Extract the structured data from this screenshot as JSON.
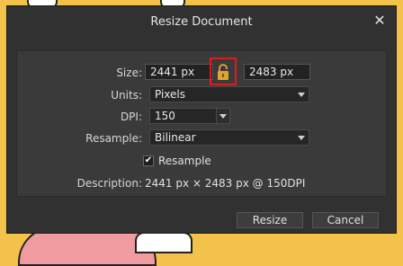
{
  "window": {
    "title": "Resize Document"
  },
  "size": {
    "label": "Size:",
    "width": "2441 px",
    "height": "2483 px"
  },
  "units": {
    "label": "Units:",
    "value": "Pixels"
  },
  "dpi": {
    "label": "DPI:",
    "value": "150"
  },
  "resample_method": {
    "label": "Resample:",
    "value": "Bilinear"
  },
  "resample_toggle": {
    "label": "Resample",
    "checked": true
  },
  "description": {
    "label": "Description:",
    "value": "2441 px × 2483 px @ 150DPI"
  },
  "buttons": {
    "resize": "Resize",
    "cancel": "Cancel"
  },
  "colors": {
    "highlight": "#e01a1a",
    "lock": "#e0a232",
    "canvas": "#f2c24a"
  }
}
